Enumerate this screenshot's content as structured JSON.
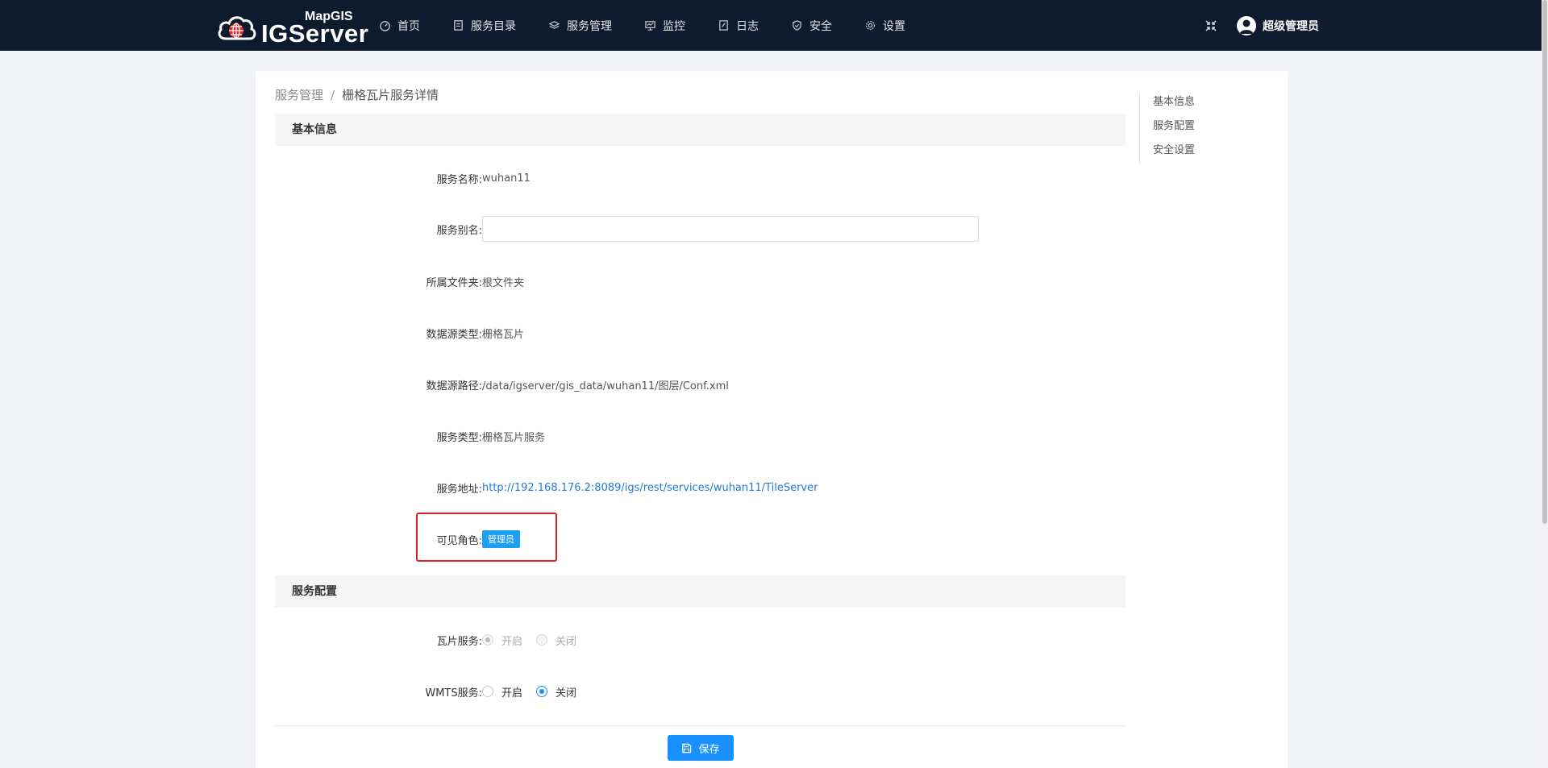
{
  "brand": {
    "small": "MapGIS",
    "big": "IGServer"
  },
  "nav": [
    {
      "label": "首页",
      "icon": "dashboard-icon"
    },
    {
      "label": "服务目录",
      "icon": "document-icon"
    },
    {
      "label": "服务管理",
      "icon": "layers-icon"
    },
    {
      "label": "监控",
      "icon": "monitor-icon"
    },
    {
      "label": "日志",
      "icon": "edit-note-icon"
    },
    {
      "label": "安全",
      "icon": "shield-icon"
    },
    {
      "label": "设置",
      "icon": "gear-icon"
    }
  ],
  "user": {
    "name": "超级管理员"
  },
  "breadcrumb": {
    "parent": "服务管理",
    "separator": "/",
    "current": "栅格瓦片服务详情"
  },
  "sections": {
    "basic": "基本信息",
    "config": "服务配置"
  },
  "fields": {
    "service_name": {
      "label": "服务名称:",
      "value": "wuhan11"
    },
    "alias": {
      "label": "服务别名:",
      "value": ""
    },
    "folder": {
      "label": "所属文件夹:",
      "value": "根文件夹"
    },
    "source_type": {
      "label": "数据源类型:",
      "value": "栅格瓦片"
    },
    "source_path": {
      "label": "数据源路径:",
      "value": "/data/igserver/gis_data/wuhan11/图层/Conf.xml"
    },
    "service_type": {
      "label": "服务类型:",
      "value": "栅格瓦片服务"
    },
    "service_url": {
      "label": "服务地址:",
      "value": "http://192.168.176.2:8089/igs/rest/services/wuhan11/TileServer"
    },
    "roles": {
      "label": "可见角色:",
      "tag": "管理员"
    }
  },
  "config": {
    "tile": {
      "label": "瓦片服务:",
      "on": "开启",
      "off": "关闭",
      "selected": "on",
      "disabled": true
    },
    "wmts": {
      "label": "WMTS服务:",
      "on": "开启",
      "off": "关闭",
      "selected": "off",
      "disabled": false
    }
  },
  "save_label": "保存",
  "anchor": [
    "基本信息",
    "服务配置",
    "安全设置"
  ]
}
